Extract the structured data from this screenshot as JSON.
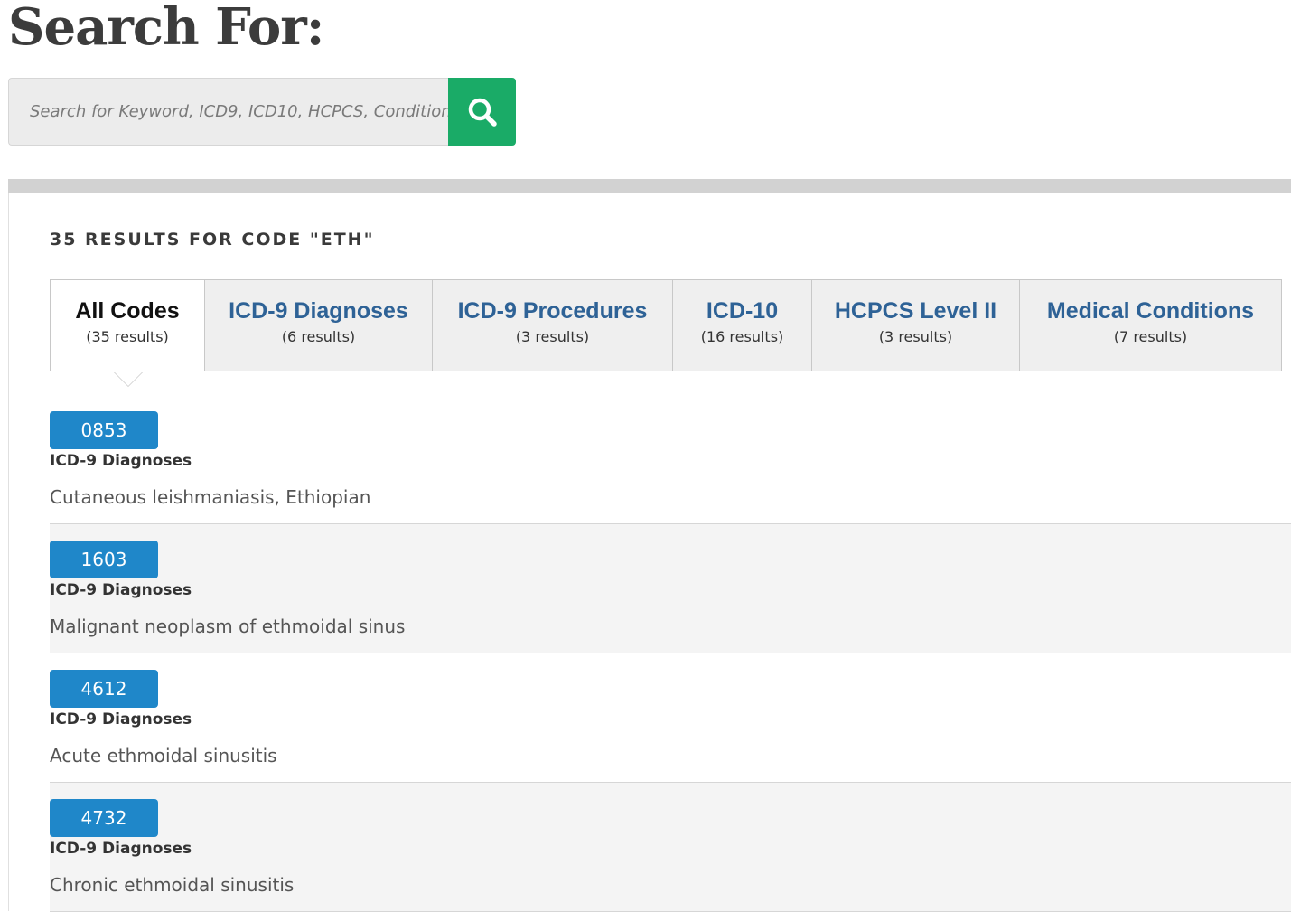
{
  "header": {
    "title": "Search For:"
  },
  "search": {
    "placeholder": "Search for Keyword, ICD9, ICD10, HCPCS, Condition",
    "value": "",
    "button_icon": "search-icon",
    "button_color": "#1aab67"
  },
  "results": {
    "heading": "35 RESULTS FOR CODE \"ETH\""
  },
  "tabs": [
    {
      "label": "All Codes",
      "count": "(35 results)",
      "active": true
    },
    {
      "label": "ICD-9 Diagnoses",
      "count": "(6 results)",
      "active": false
    },
    {
      "label": "ICD-9 Procedures",
      "count": "(3 results)",
      "active": false
    },
    {
      "label": "ICD-10",
      "count": "(16 results)",
      "active": false
    },
    {
      "label": "HCPCS Level II",
      "count": "(3 results)",
      "active": false
    },
    {
      "label": "Medical Conditions",
      "count": "(7 results)",
      "active": false
    }
  ],
  "items": [
    {
      "code": "0853",
      "category": "ICD-9 Diagnoses",
      "description": "Cutaneous leishmaniasis, Ethiopian"
    },
    {
      "code": "1603",
      "category": "ICD-9 Diagnoses",
      "description": "Malignant neoplasm of ethmoidal sinus"
    },
    {
      "code": "4612",
      "category": "ICD-9 Diagnoses",
      "description": "Acute ethmoidal sinusitis"
    },
    {
      "code": "4732",
      "category": "ICD-9 Diagnoses",
      "description": "Chronic ethmoidal sinusitis"
    }
  ],
  "colors": {
    "badge": "#1f87c9",
    "tab_link": "#2e6296",
    "accent_green": "#1aab67"
  }
}
